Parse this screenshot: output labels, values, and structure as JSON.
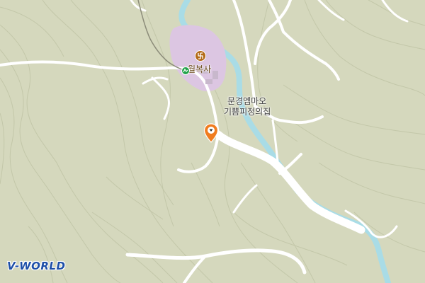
{
  "map": {
    "background_color": "#d5d8bd",
    "contour_color": "#c3c7a9",
    "road_color": "#ffffff",
    "river_color": "#a9dce6",
    "temple_area_color": "#dcc6e2"
  },
  "places": {
    "temple": {
      "name": "월복사",
      "icon": "temple-manji-icon"
    },
    "restaurant": {
      "name_line1": "문경엠마오",
      "name_line2": "기쁨피정의집"
    }
  },
  "markers": {
    "location_pin": {
      "icon": "location-pin-icon",
      "color": "#f07c1e"
    },
    "trail_marker": {
      "icon": "hiking-trail-icon",
      "color": "#22a34a"
    }
  },
  "branding": {
    "logo_text": "V-WORLD"
  }
}
